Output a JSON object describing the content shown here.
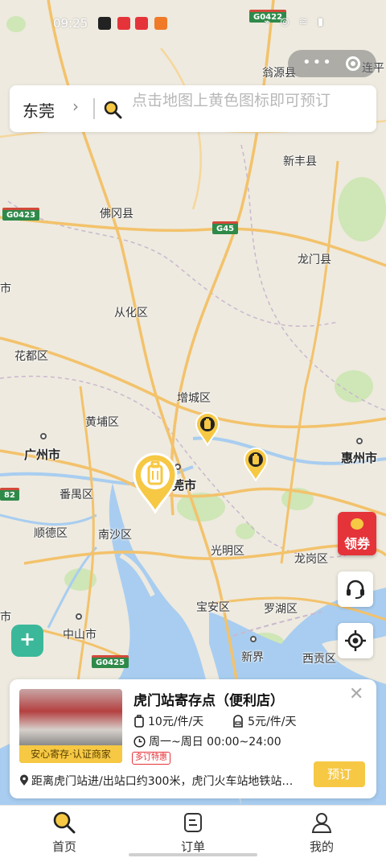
{
  "status_bar": {
    "time": "09:25",
    "system": "⌁ ◎ ≋ ▮",
    "route_shield": "G0422"
  },
  "search": {
    "city": "东莞",
    "chevron": "›",
    "placeholder": "点击地图上黄色图标即可预订"
  },
  "map": {
    "labels": {
      "wengyuan": "翁源县",
      "lianping": "连平",
      "xinfeng": "新丰县",
      "fogang": "佛冈县",
      "longmen": "龙门县",
      "conghua": "从化区",
      "huadu": "花都区",
      "zengcheng": "增城区",
      "huangpu": "黄埔区",
      "guangzhou": "广州市",
      "dongguan": "莞市",
      "huizhou": "惠州市",
      "panyu": "番禺区",
      "shunde": "顺德区",
      "nansha": "南沙区",
      "guangming": "光明区",
      "longgang": "龙岗区",
      "baoan": "宝安区",
      "luohu": "罗湖区",
      "zhongshan": "中山市",
      "xinjie": "新界",
      "xigong": "西贡区",
      "shi": "市"
    },
    "shields": {
      "g0423": "G0423",
      "g45": "G45",
      "g0425": "G0425",
      "s82": "82"
    }
  },
  "coupon": {
    "label": "领券"
  },
  "card": {
    "name": "虎门站寄存点（便利店）",
    "badge": "安心寄存·认证商家",
    "price_large": "10元/件/天",
    "price_small": "5元/件/天",
    "hours": "周一~周日 00:00~24:00",
    "promo": "多订特惠",
    "address": "距离虎门站进/出站口约300米，虎门火车站地铁站…",
    "book_label": "预订",
    "close": "✕"
  },
  "tabs": [
    {
      "label": "首页",
      "icon": "search-icon"
    },
    {
      "label": "订单",
      "icon": "orders-icon"
    },
    {
      "label": "我的",
      "icon": "profile-icon"
    }
  ],
  "colors": {
    "accent": "#f6c844",
    "map_bg": "#eeeadf",
    "water": "#a8cdf0",
    "highway": "#f3c26b",
    "coupon": "#e5333a",
    "shield_btn": "#3bb89a"
  }
}
